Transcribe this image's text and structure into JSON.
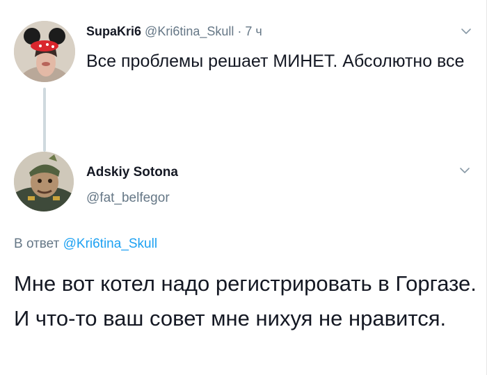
{
  "tweets": [
    {
      "display_name": "SupaKri6",
      "handle": "@Kri6tina_Skull",
      "separator": "·",
      "time": "7 ч",
      "text": "Все проблемы решает МИНЕТ. Абсолютно все",
      "avatar_icon": "avatar-mickey-ears-icon"
    },
    {
      "display_name": "Adskiy Sotona",
      "handle": "@fat_belfegor",
      "reply_prefix": "В ответ",
      "reply_to": "@Kri6tina_Skull",
      "text": "Мне вот котел надо регистрировать в Горгазе. И что-то ваш совет мне нихуя не нравится.",
      "avatar_icon": "avatar-military-figure-icon"
    }
  ],
  "colors": {
    "text": "#141823",
    "muted": "#657786",
    "link": "#1da1f2",
    "thread_line": "#cfd9de"
  },
  "icons": {
    "menu": "chevron-down-icon"
  }
}
